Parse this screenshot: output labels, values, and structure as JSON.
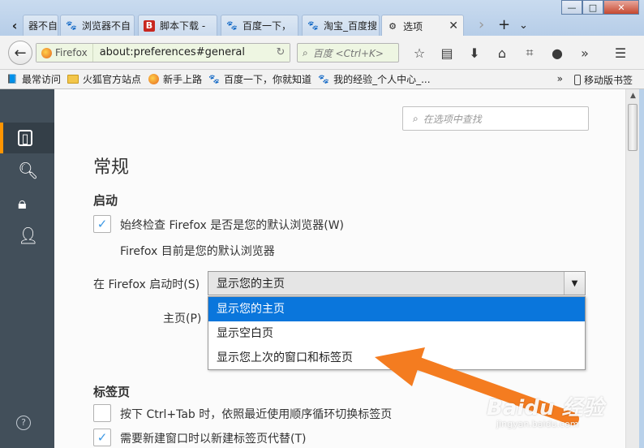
{
  "tabs": [
    {
      "label": "器不自",
      "icon": "paw-icon"
    },
    {
      "label": "浏览器不自",
      "icon": "paw-icon"
    },
    {
      "label": "脚本下载 -",
      "icon": "jb-icon"
    },
    {
      "label": "百度一下，",
      "icon": "paw-icon"
    },
    {
      "label": "淘宝_百度搜",
      "icon": "paw-icon"
    },
    {
      "label": "选项",
      "icon": "gear-icon"
    }
  ],
  "window_controls": {
    "minimize": "—",
    "maximize": "□",
    "close": "✕"
  },
  "navbar": {
    "identity_label": "Firefox",
    "url": "about:preferences#general",
    "search_placeholder": "百度 <Ctrl+K>"
  },
  "bookmarks": [
    {
      "label": "最常访问",
      "icon": "bookmark-icon"
    },
    {
      "label": "火狐官方站点",
      "icon": "folder-icon"
    },
    {
      "label": "新手上路",
      "icon": "firefox-icon"
    },
    {
      "label": "百度一下，你就知道",
      "icon": "paw-icon"
    },
    {
      "label": "我的经验_个人中心_...",
      "icon": "paw-icon"
    }
  ],
  "bookmarks_more": "»",
  "mobile_bookmarks": "移动版书签",
  "preferences": {
    "find_placeholder": "在选项中查找",
    "title": "常规",
    "startup_heading": "启动",
    "default_check_label": "始终检查 Firefox 是否是您的默认浏览器(W)",
    "default_status": "Firefox 目前是您的默认浏览器",
    "on_startup_label": "在 Firefox 启动时(S)",
    "on_startup_value": "显示您的主页",
    "homepage_label": "主页(P)",
    "startup_options": [
      "显示您的主页",
      "显示空白页",
      "显示您上次的窗口和标签页"
    ],
    "selected_option_index": 0,
    "tabs_heading": "标签页",
    "ctrl_tab_label": "按下 Ctrl+Tab 时，依照最近使用顺序循环切换标签页",
    "ctrl_tab_checked": false,
    "new_tab_label": "需要新建窗口时以新建标签页代替(T)",
    "new_tab_checked": true,
    "default_check_checked": true
  },
  "watermark": {
    "text": "Baidu 经验",
    "sub": "jingyan.baidu.com"
  },
  "colors": {
    "accent": "#ff9500",
    "selected": "#0a76dc",
    "sidebar": "#424f5a",
    "arrow": "#f47c20"
  }
}
